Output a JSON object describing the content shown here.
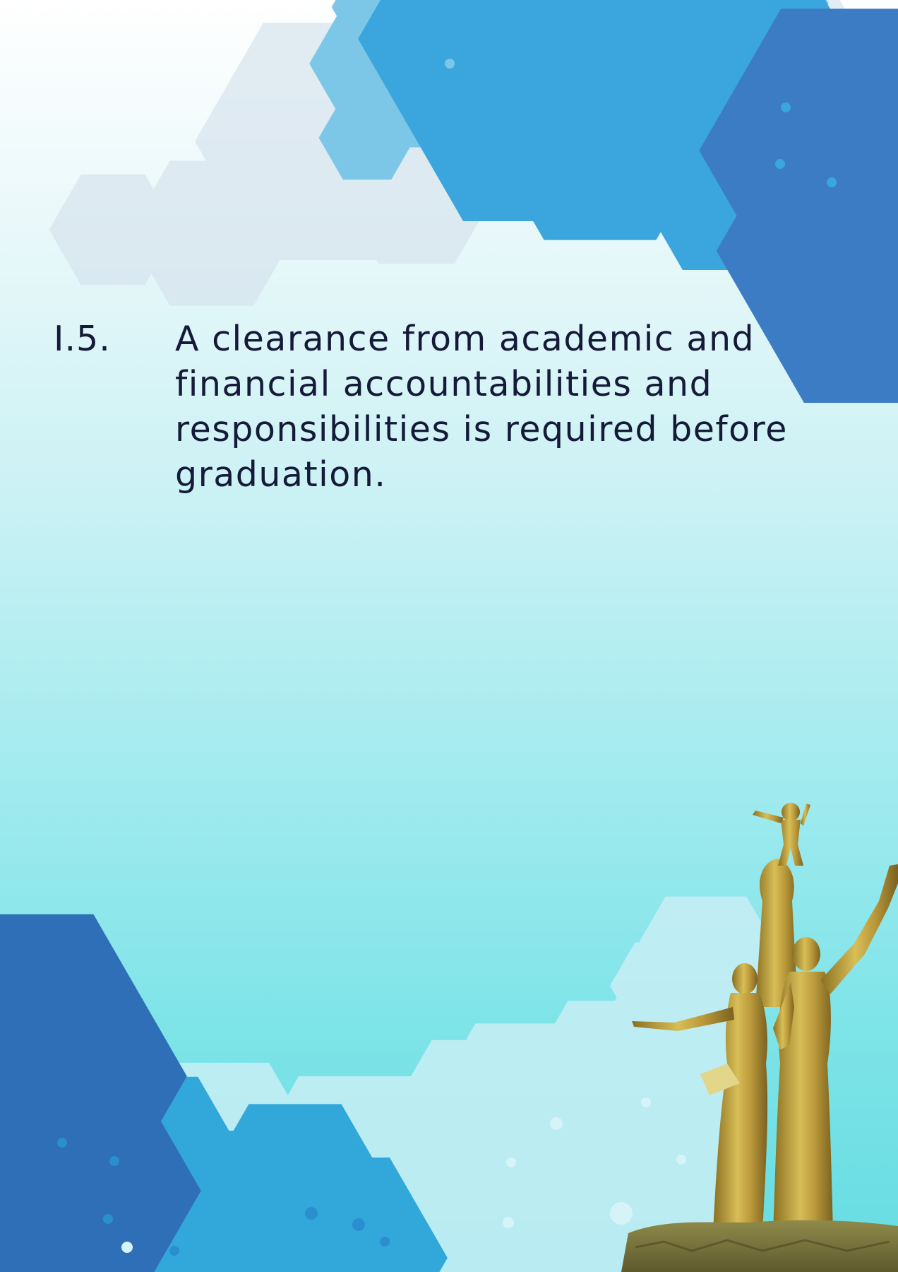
{
  "section": {
    "number": "I.5.",
    "text": "A clearance from academic and financial accountabilities and responsibilities is required before graduation."
  },
  "colors": {
    "background_top": "#ffffff",
    "background_bottom": "#64dce2",
    "text": "#141a38",
    "hex_accent": "#3aa6dd",
    "hex_dark": "#2f6fb8",
    "statue": "#c3a33c"
  },
  "decorations": {
    "top_right": "hexagon-network-pattern",
    "bottom_left": "hexagon-network-pattern",
    "bottom_right": "golden-statue-monument"
  }
}
